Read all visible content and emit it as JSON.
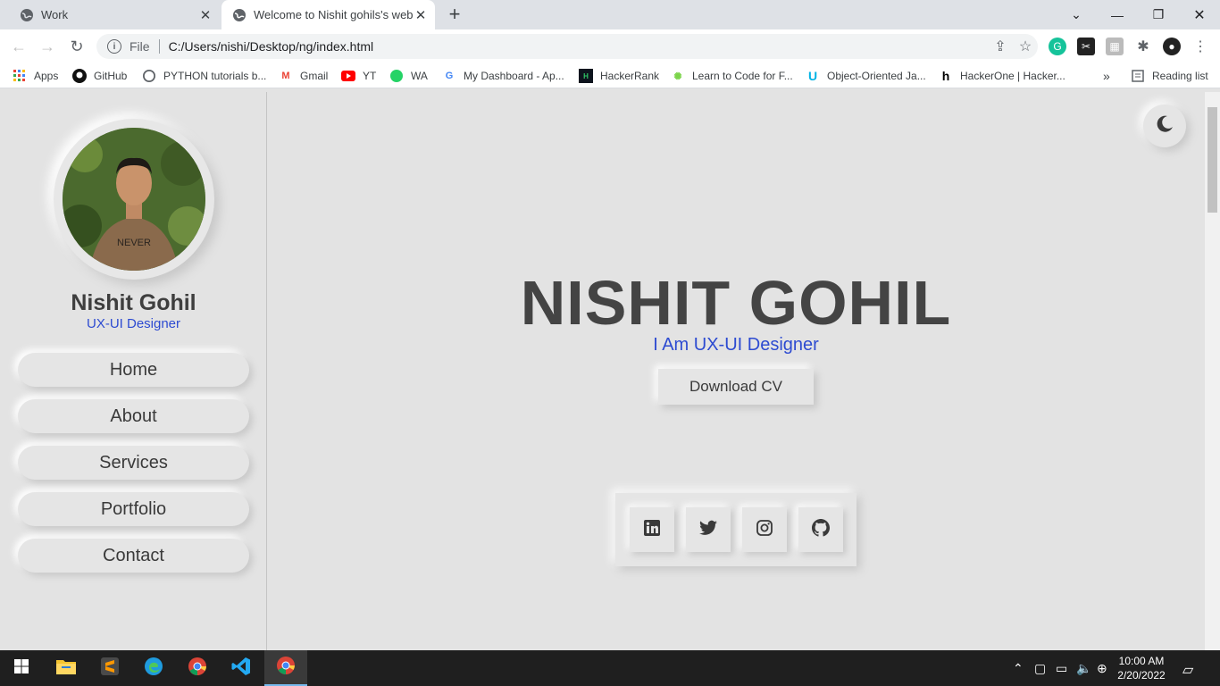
{
  "browser": {
    "tabs": [
      {
        "title": "Work"
      },
      {
        "title": "Welcome to Nishit gohils's websi"
      }
    ],
    "address": {
      "scheme_label": "File",
      "url": "C:/Users/nishi/Desktop/ng/index.html"
    },
    "bookmarks": [
      {
        "label": "Apps",
        "icon": "apps-icon"
      },
      {
        "label": "GitHub",
        "icon": "github-icon"
      },
      {
        "label": "PYTHON tutorials b...",
        "icon": "python-icon"
      },
      {
        "label": "Gmail",
        "icon": "gmail-icon"
      },
      {
        "label": "YT",
        "icon": "youtube-icon"
      },
      {
        "label": "WA",
        "icon": "whatsapp-icon"
      },
      {
        "label": "My Dashboard - Ap...",
        "icon": "google-icon"
      },
      {
        "label": "HackerRank",
        "icon": "hackerrank-icon"
      },
      {
        "label": "Learn to Code for F...",
        "icon": "freecodecamp-icon"
      },
      {
        "label": "Object-Oriented Ja...",
        "icon": "udacity-icon"
      },
      {
        "label": "HackerOne | Hacker...",
        "icon": "hackerone-icon"
      }
    ],
    "more_bookmarks": "»",
    "reading_list": "Reading list"
  },
  "sidebar": {
    "name": "Nishit Gohil",
    "role": "UX-UI Designer",
    "nav": [
      {
        "label": "Home"
      },
      {
        "label": "About"
      },
      {
        "label": "Services"
      },
      {
        "label": "Portfolio"
      },
      {
        "label": "Contact"
      }
    ]
  },
  "hero": {
    "title": "NISHIT GOHIL",
    "subtitle": "I Am UX-UI Designer",
    "cta": "Download CV",
    "socials": [
      "linkedin-icon",
      "twitter-icon",
      "instagram-icon",
      "github-icon"
    ]
  },
  "taskbar": {
    "time": "10:00 AM",
    "date": "2/20/2022"
  },
  "colors": {
    "accent": "#2d4bd1",
    "background": "#e3e3e3",
    "heading": "#444444"
  }
}
